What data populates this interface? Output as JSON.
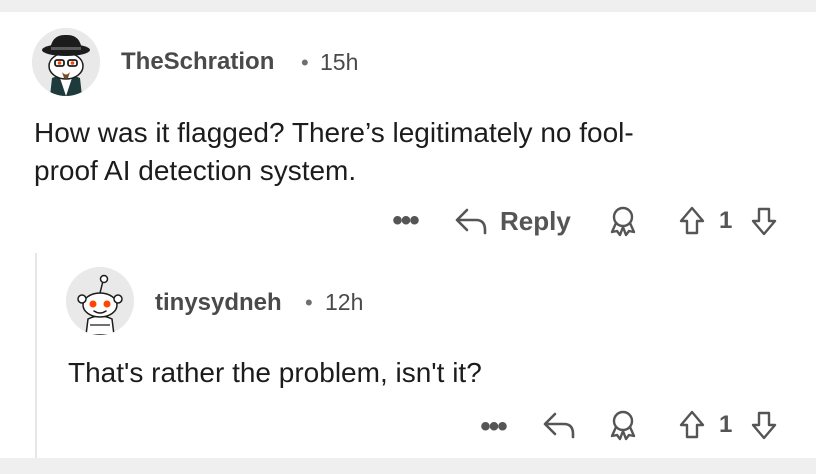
{
  "comment1": {
    "username": "TheSchration",
    "separator": "•",
    "time": "15h",
    "text_line1": "How was it flagged? There’s legitimately no fool-",
    "text_line2": "proof AI detection system.",
    "actions": {
      "more": "•••",
      "reply_label": "Reply",
      "award_icon": "award-icon",
      "upvote_icon": "upvote-icon",
      "vote_count": "1",
      "downvote_icon": "downvote-icon"
    }
  },
  "comment2": {
    "username": "tinysydneh",
    "separator": "•",
    "time": "12h",
    "text": "That's rather the problem, isn't it?",
    "actions": {
      "more": "•••",
      "reply_icon": "reply-icon",
      "award_icon": "award-icon",
      "upvote_icon": "upvote-icon",
      "vote_count": "1",
      "downvote_icon": "downvote-icon"
    }
  },
  "colors": {
    "text": "#1c1c1c",
    "meta": "#4a4a4a",
    "icon": "#555555",
    "avatar_bg": "#e9e9ea",
    "snoo_eye": "#ff4500"
  }
}
